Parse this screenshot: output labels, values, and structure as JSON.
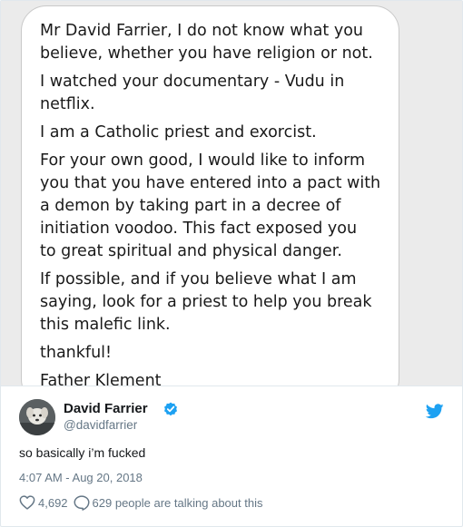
{
  "letter": {
    "paragraphs": [
      "Mr David Farrier, I do not know what you\nbelieve, whether you have religion or not.",
      "I watched your documentary - Vudu in\nnetflix.",
      "I am a Catholic priest and exorcist.",
      "For your own good, I would like to inform\nyou that you have entered into a pact with\na demon by taking part in a decree of\ninitiation voodoo. This fact exposed you\nto great spiritual and physical danger.",
      "If possible, and if you believe what I am\nsaying, look for a priest to help you break\nthis malefic link.",
      "thankful!",
      "Father Klement"
    ]
  },
  "author": {
    "name": "David Farrier",
    "handle": "@davidfarrier",
    "verified": true
  },
  "tweet": {
    "text": "so basically i’m fucked",
    "timestamp": "4:07 AM - Aug 20, 2018"
  },
  "actions": {
    "likes": "4,692",
    "conversation": "629 people are talking about this"
  },
  "colors": {
    "brand": "#1da1f2",
    "secondary_text": "#657786",
    "primary_text": "#14171a"
  },
  "icons": {
    "verified": "verified-badge-icon",
    "twitter": "twitter-bird-icon",
    "like": "heart-icon",
    "reply": "speech-bubble-icon"
  }
}
